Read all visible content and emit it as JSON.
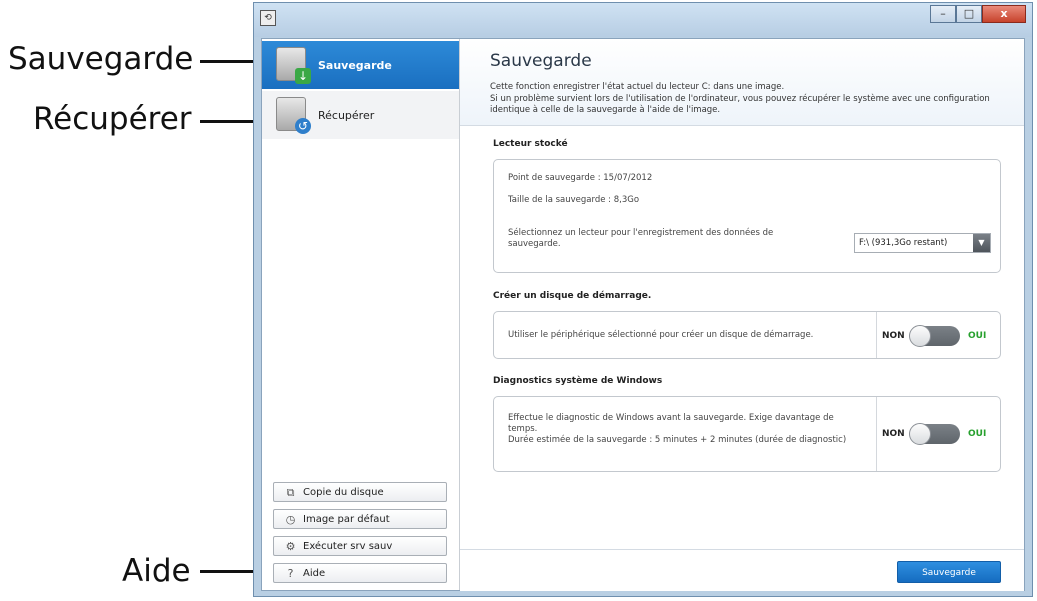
{
  "callouts": {
    "sauvegarde": "Sauvegarde",
    "recuperer": "Récupérer",
    "aide": "Aide"
  },
  "window": {
    "buttons": {
      "minimize": "–",
      "maximize": "□",
      "close": "x"
    }
  },
  "sidebar": {
    "items": [
      {
        "label": "Sauvegarde",
        "icon": "backup-down-arrow-icon",
        "active": true
      },
      {
        "label": "Récupérer",
        "icon": "restore-arrow-icon",
        "active": false
      }
    ],
    "bottom_buttons": [
      {
        "label": "Copie du disque",
        "icon": "disk-copy-icon"
      },
      {
        "label": "Image par défaut",
        "icon": "default-image-icon"
      },
      {
        "label": "Exécuter srv sauv",
        "icon": "run-service-icon"
      },
      {
        "label": "Aide",
        "icon": "help-icon"
      }
    ]
  },
  "main": {
    "title": "Sauvegarde",
    "description": [
      "Cette fonction enregistrer l'état actuel du lecteur C: dans une image.",
      "Si un problème survient lors de l'utilisation de l'ordinateur, vous pouvez récupérer le système avec une configuration",
      "identique à celle de la sauvegarde à l'aide de l'image."
    ],
    "stored_drive": {
      "title": "Lecteur stocké",
      "backup_point": "Point de sauvegarde : 15/07/2012",
      "backup_size": "Taille de la sauvegarde : 8,3Go",
      "select_text_1": "Sélectionnez un lecteur pour l'enregistrement des données de",
      "select_text_2": "sauvegarde.",
      "selected_drive": "F:\\ (931,3Go restant)"
    },
    "boot_disk": {
      "title": "Créer un disque de démarrage.",
      "text": "Utiliser le périphérique sélectionné pour créer un disque de démarrage.",
      "toggle_off": "NON",
      "toggle_on": "OUI"
    },
    "diagnostics": {
      "title": "Diagnostics système de Windows",
      "text_1": "Effectue le diagnostic de Windows avant la sauvegarde. Exige davantage de",
      "text_2": "temps.",
      "text_3": "Durée estimée de la sauvegarde : 5 minutes + 2 minutes (durée de diagnostic)",
      "toggle_off": "NON",
      "toggle_on": "OUI"
    },
    "save_button": "Sauvegarde"
  },
  "colors": {
    "accent": "#1a6fc0",
    "oui_green": "#27a02e",
    "callout_dot": "#1f7fcf"
  }
}
